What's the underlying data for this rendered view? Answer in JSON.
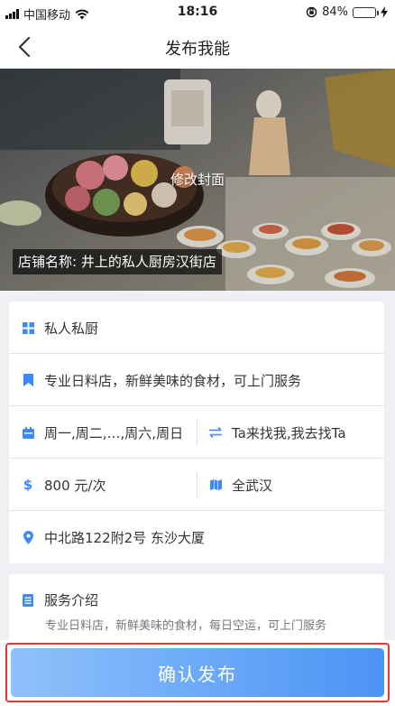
{
  "status_bar": {
    "carrier": "中国移动",
    "time": "18:16",
    "battery": "84%",
    "battery_level": 0.84
  },
  "nav": {
    "title": "发布我能",
    "back_icon": "chevron-left-icon"
  },
  "cover": {
    "edit_label": "修改封面",
    "shop_name": "店铺名称: 井上的私人厨房汉街店"
  },
  "form": {
    "category": "私人私厨",
    "description": "专业日料店，新鲜美味的食材，可上门服务",
    "days": "周一,周二,…,周六,周日",
    "meet_mode": "Ta来找我,我去找Ta",
    "price": "800 元/次",
    "area": "全武汉",
    "address": "中北路122附2号 东沙大厦"
  },
  "intro": {
    "title": "服务介绍",
    "text": "专业日料店，新鲜美味的食材，每日空运，可上门服务"
  },
  "confirm": {
    "label": "确认发布"
  },
  "colors": {
    "accent": "#3d8af7",
    "button_gradient_start": "#8fc1fb",
    "button_gradient_end": "#4b93f5",
    "highlight_border": "#e53935",
    "battery": "#4cd964"
  }
}
